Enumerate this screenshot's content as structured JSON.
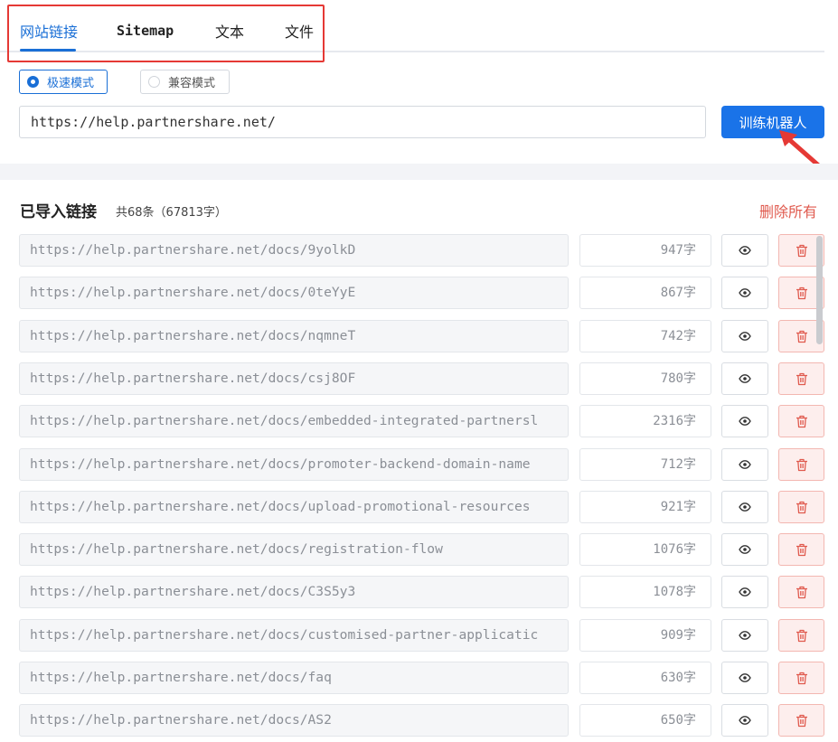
{
  "tabs": [
    {
      "label": "网站链接",
      "active": true
    },
    {
      "label": "Sitemap",
      "active": false
    },
    {
      "label": "文本",
      "active": false
    },
    {
      "label": "文件",
      "active": false
    }
  ],
  "modes": [
    {
      "label": "极速模式",
      "selected": true
    },
    {
      "label": "兼容模式",
      "selected": false
    }
  ],
  "url_input": {
    "value": "https://help.partnershare.net/"
  },
  "train_button": {
    "label": "训练机器人"
  },
  "imported": {
    "title": "已导入链接",
    "count_text": "共68条（67813字）",
    "delete_all_label": "删除所有",
    "unit": "字",
    "links": [
      {
        "url": "https://help.partnershare.net/docs/9yolkD",
        "chars": "947"
      },
      {
        "url": "https://help.partnershare.net/docs/0teYyE",
        "chars": "867"
      },
      {
        "url": "https://help.partnershare.net/docs/nqmneT",
        "chars": "742"
      },
      {
        "url": "https://help.partnershare.net/docs/csj8OF",
        "chars": "780"
      },
      {
        "url": "https://help.partnershare.net/docs/embedded-integrated-partnersl",
        "chars": "2316"
      },
      {
        "url": "https://help.partnershare.net/docs/promoter-backend-domain-name",
        "chars": "712"
      },
      {
        "url": "https://help.partnershare.net/docs/upload-promotional-resources",
        "chars": "921"
      },
      {
        "url": "https://help.partnershare.net/docs/registration-flow",
        "chars": "1076"
      },
      {
        "url": "https://help.partnershare.net/docs/C3S5y3",
        "chars": "1078"
      },
      {
        "url": "https://help.partnershare.net/docs/customised-partner-applicatic",
        "chars": "909"
      },
      {
        "url": "https://help.partnershare.net/docs/faq",
        "chars": "630"
      },
      {
        "url": "https://help.partnershare.net/docs/AS2",
        "chars": "650"
      }
    ]
  },
  "colors": {
    "accent": "#1a73e8",
    "danger": "#e05a4e",
    "annotation": "#e53935"
  },
  "icons": {
    "view": "eye-icon",
    "delete": "trash-icon",
    "annotation_arrow": "red-arrow-icon"
  }
}
